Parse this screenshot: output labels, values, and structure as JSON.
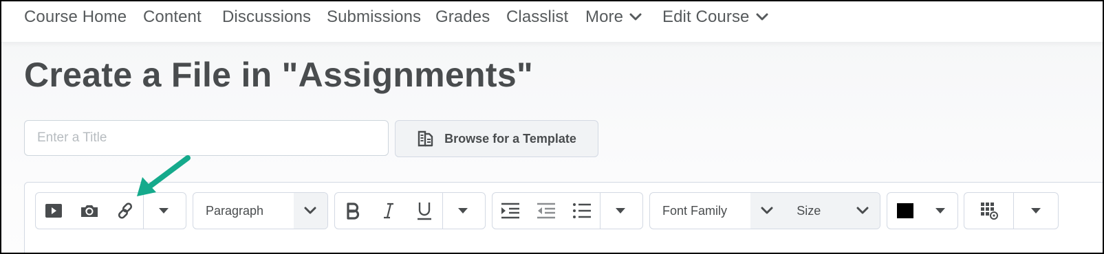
{
  "nav": {
    "items": [
      {
        "label": "Course Home"
      },
      {
        "label": "Content"
      },
      {
        "label": "Discussions"
      },
      {
        "label": "Submissions"
      },
      {
        "label": "Grades"
      },
      {
        "label": "Classlist"
      },
      {
        "label": "More"
      },
      {
        "label": "Edit Course"
      }
    ]
  },
  "page": {
    "title": "Create a File in \"Assignments\""
  },
  "form": {
    "title_placeholder": "Enter a Title",
    "title_value": "",
    "browse_label": "Browse for a Template"
  },
  "toolbar": {
    "paragraph_label": "Paragraph",
    "font_family_label": "Font Family",
    "size_label": "Size",
    "text_color": "#000000",
    "icons": [
      "play-icon",
      "camera-icon",
      "link-icon",
      "bold-icon",
      "italic-icon",
      "underline-icon",
      "indent-icon",
      "outdent-icon",
      "bullet-list-icon",
      "table-icon",
      "dropdown-caret-icon"
    ]
  },
  "annotation": {
    "arrow_color": "#15aa8c"
  },
  "colors": {
    "text": "#494c4e",
    "nav_text": "#565a5c",
    "border": "#d3d9e3",
    "placeholder": "#b7bcc0"
  }
}
